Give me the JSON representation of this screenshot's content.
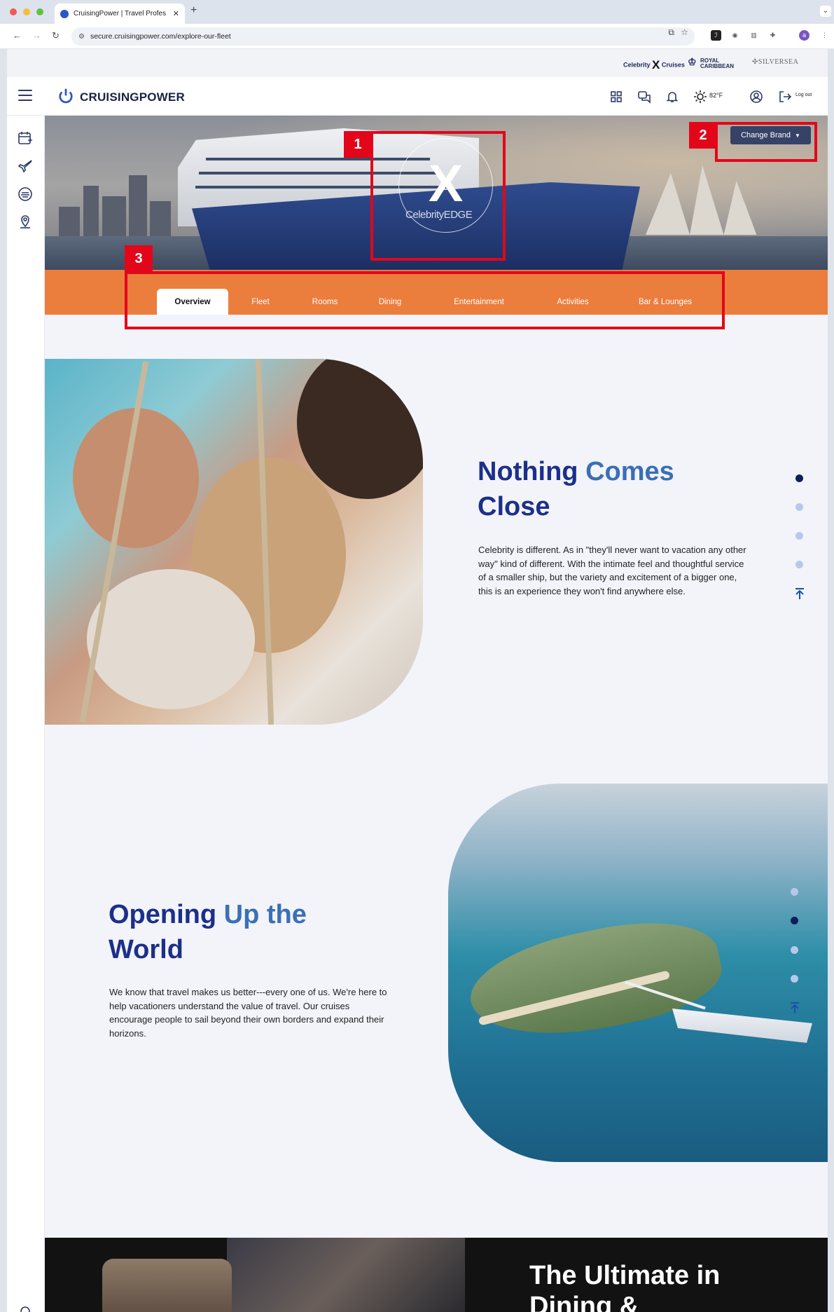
{
  "browser": {
    "tab_title": "CruisingPower | Travel Profes",
    "url": "secure.cruisingpower.com/explore-our-fleet",
    "profile_initial": "a"
  },
  "brands": {
    "celebrity_small": "Celebrity",
    "celebrity_cruises": "Cruises",
    "royal_line1": "ROYAL",
    "royal_line2": "CARIBBEAN",
    "silversea": "SILVERSEA"
  },
  "header": {
    "logo_text": "CRUISINGPOWER",
    "temperature": "82°F",
    "logout_label": "Log out"
  },
  "hero": {
    "badge_letter": "X",
    "ship_name": "CelebrityEDGE",
    "change_brand_label": "Change Brand"
  },
  "tabs": [
    {
      "label": "Overview",
      "active": true
    },
    {
      "label": "Fleet",
      "active": false
    },
    {
      "label": "Rooms",
      "active": false
    },
    {
      "label": "Dining",
      "active": false
    },
    {
      "label": "Entertainment",
      "active": false
    },
    {
      "label": "Activities",
      "active": false
    },
    {
      "label": "Bar & Lounges",
      "active": false
    }
  ],
  "annotations": [
    "1",
    "2",
    "3"
  ],
  "sections": [
    {
      "title_primary": "Nothing",
      "title_accent": "Comes",
      "title_rest": "Close",
      "body": "Celebrity is different. As in \"they'll never want to vacation any other way\" kind of different. With the intimate feel and thoughtful service of a smaller ship, but the variety and excitement of a bigger one, this is an experience they won't find anywhere else.",
      "active_dot": 1
    },
    {
      "title_primary": "Opening",
      "title_accent": "Up the",
      "title_rest": "World",
      "body": "We know that travel makes us better---every one of us. We're here to help vacationers understand the value of travel. Our cruises encourage people to sail beyond their own borders and expand their horizons.",
      "active_dot": 2
    },
    {
      "title_line1": "The Ultimate in",
      "title_line2": "Dining &"
    }
  ],
  "colors": {
    "tab_band": "#eb7d3d",
    "title_navy": "#1c2f8a",
    "title_accent": "#3b6fb5",
    "annotation_red": "#e3061a",
    "change_brand_bg": "#364266"
  }
}
